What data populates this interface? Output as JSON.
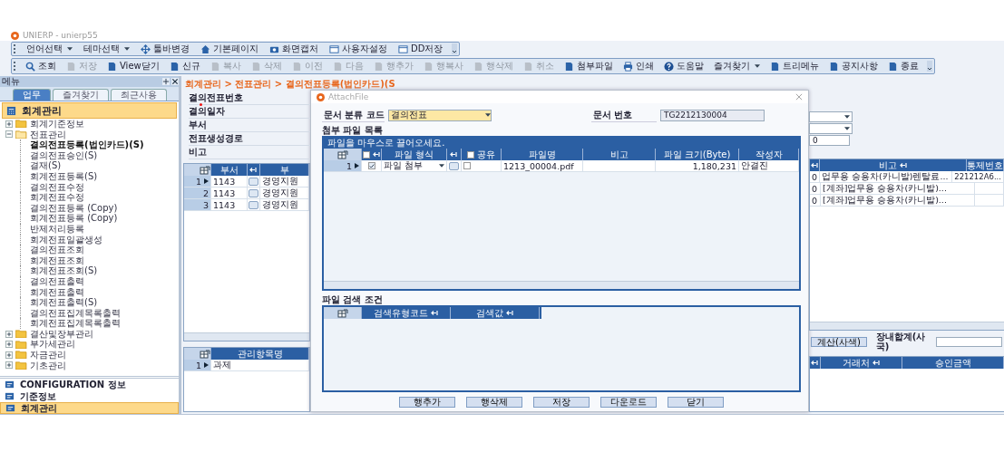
{
  "window": {
    "title": "UNIERP - unierp55"
  },
  "toolbar_top": [
    {
      "label": "언어선택",
      "dropdown": true,
      "kind": "none"
    },
    {
      "label": "테마선택",
      "dropdown": true,
      "kind": "none"
    },
    {
      "label": "툴바변경",
      "dropdown": false,
      "kind": "move"
    },
    {
      "label": "기본페이지",
      "dropdown": false,
      "kind": "home"
    },
    {
      "label": "화면캡처",
      "dropdown": false,
      "kind": "camera"
    },
    {
      "label": "사용자설정",
      "dropdown": false,
      "kind": "page"
    },
    {
      "label": "DD저장",
      "dropdown": false,
      "kind": "page"
    }
  ],
  "toolbar_main": [
    {
      "label": "조회",
      "kind": "search",
      "disabled": false,
      "dropdown": false
    },
    {
      "label": "저장",
      "kind": "page",
      "disabled": true,
      "dropdown": false
    },
    {
      "label": "View닫기",
      "kind": "page",
      "disabled": false,
      "dropdown": false
    },
    {
      "label": "신규",
      "kind": "page",
      "disabled": false,
      "dropdown": false
    },
    {
      "label": "복사",
      "kind": "page",
      "disabled": true,
      "dropdown": false
    },
    {
      "label": "삭제",
      "kind": "page",
      "disabled": true,
      "dropdown": false
    },
    {
      "label": "이전",
      "kind": "page",
      "disabled": true,
      "dropdown": false
    },
    {
      "label": "다음",
      "kind": "page",
      "disabled": true,
      "dropdown": false
    },
    {
      "label": "행추가",
      "kind": "page",
      "disabled": true,
      "dropdown": false
    },
    {
      "label": "행복사",
      "kind": "page",
      "disabled": true,
      "dropdown": false
    },
    {
      "label": "행삭제",
      "kind": "page",
      "disabled": true,
      "dropdown": false
    },
    {
      "label": "취소",
      "kind": "page",
      "disabled": true,
      "dropdown": false
    },
    {
      "label": "첨부파일",
      "kind": "page",
      "disabled": false,
      "dropdown": false
    },
    {
      "label": "인쇄",
      "kind": "print",
      "disabled": false,
      "dropdown": false
    },
    {
      "label": "도움말",
      "kind": "help",
      "disabled": false,
      "dropdown": false
    },
    {
      "label": "즐겨찾기",
      "kind": "none",
      "disabled": false,
      "dropdown": true
    },
    {
      "label": "트리메뉴",
      "kind": "page",
      "disabled": false,
      "dropdown": false
    },
    {
      "label": "공지사항",
      "kind": "page",
      "disabled": false,
      "dropdown": false
    },
    {
      "label": "종료",
      "kind": "page",
      "disabled": false,
      "dropdown": false
    }
  ],
  "sidebar": {
    "title": "메뉴",
    "tabs": [
      {
        "label": "업무",
        "selected": true
      },
      {
        "label": "즐겨찾기",
        "selected": false
      },
      {
        "label": "최근사용",
        "selected": false
      }
    ],
    "module": "회계관리",
    "tree": [
      {
        "label": "회계기준정보",
        "expanded": false
      },
      {
        "label": "전표관리",
        "expanded": true,
        "children": [
          {
            "label": "결의전표등록(법인카드)(S)",
            "selected": true
          },
          {
            "label": "결의전표승인(S)",
            "selected": false
          },
          {
            "label": "결재(S)",
            "selected": false
          },
          {
            "label": "회계전표등록(S)",
            "selected": false
          },
          {
            "label": "결의전표수정",
            "selected": false
          },
          {
            "label": "회계전표수정",
            "selected": false
          },
          {
            "label": "결의전표등록 (Copy)",
            "selected": false
          },
          {
            "label": "회계전표등록 (Copy)",
            "selected": false
          },
          {
            "label": "반제처리등록",
            "selected": false
          },
          {
            "label": "회계전표일괄생성",
            "selected": false
          },
          {
            "label": "결의전표조회",
            "selected": false
          },
          {
            "label": "회계전표조회",
            "selected": false
          },
          {
            "label": "회계전표조회(S)",
            "selected": false
          },
          {
            "label": "결의전표출력",
            "selected": false
          },
          {
            "label": "회계전표출력",
            "selected": false
          },
          {
            "label": "회계전표출력(S)",
            "selected": false
          },
          {
            "label": "결의전표집계목록출력",
            "selected": false
          },
          {
            "label": "회계전표집계목록출력",
            "selected": false
          }
        ]
      },
      {
        "label": "결산및장부관리",
        "expanded": false
      },
      {
        "label": "부가세관리",
        "expanded": false
      },
      {
        "label": "자금관리",
        "expanded": false
      },
      {
        "label": "기초관리",
        "expanded": false
      }
    ],
    "footer": [
      {
        "label": "CONFIGURATION 정보",
        "selected": false
      },
      {
        "label": "기준정보",
        "selected": false
      },
      {
        "label": "회계관리",
        "selected": true
      }
    ]
  },
  "breadcrumb": "회계관리 > 전표관리 > 결의전표등록(법인카드)(S",
  "form": [
    {
      "label": "결의전표번호",
      "required": false
    },
    {
      "label": "결의일자",
      "required": true
    },
    {
      "label": "부서",
      "required": false
    },
    {
      "label": "전표생성경로",
      "required": false
    },
    {
      "label": "비고",
      "required": false
    }
  ],
  "main_grid": {
    "columns": [
      "부서",
      "부"
    ],
    "rows": [
      {
        "num": "1",
        "current": true,
        "dept": "1143",
        "name": "경영지원"
      },
      {
        "num": "2",
        "current": false,
        "dept": "1143",
        "name": "경영지원"
      },
      {
        "num": "3",
        "current": false,
        "dept": "1143",
        "name": "경영지원"
      }
    ]
  },
  "detail_grid": {
    "columns": [
      "관리항목명"
    ],
    "rows": [
      {
        "num": "1",
        "current": true,
        "item": "과제"
      }
    ]
  },
  "right_panel": {
    "value_field": "0",
    "grid": {
      "columns": [
        "비고",
        "통제번호"
      ],
      "rows": [
        {
          "column_1": "0",
          "note": "업무용 승용차(카니발)렌탈료...",
          "control_no": "221212A6..."
        },
        {
          "column_1": "0",
          "note": "[계좌]업무용 승용차(카니발)..."
        },
        {
          "column_1": "0",
          "note": "[계좌]업무용 승용차(카니발)..."
        }
      ]
    },
    "calc_button": "계산(사색)",
    "total_label": "장내합계(사국)",
    "lower_grid": {
      "columns": [
        "거래처",
        "승인금액"
      ]
    }
  },
  "dialog": {
    "title": "AttachFile",
    "doc_class": {
      "label": "문서 분류 코드",
      "value": "결의전표"
    },
    "doc_no": {
      "label": "문서 번호",
      "value": "TG2212130004"
    },
    "list_title": "첨부 파일 목록",
    "drop_hint": "파일을 마우스로 끌어오세요.",
    "file_grid": {
      "all_checked": false,
      "all_shared": false,
      "columns": [
        "파일 형식",
        "공유",
        "파일명",
        "비고",
        "파일 크기(Byte)",
        "작성자"
      ],
      "rows": [
        {
          "num": "1",
          "current": true,
          "checked": true,
          "file_type": "파일 첨부",
          "shared": false,
          "file_name": "1213_00004.pdf",
          "size": "1,180,231",
          "author": "안결진"
        }
      ]
    },
    "search_title": "파일 검색 조건",
    "search_columns": [
      "검색유형코드",
      "검색값"
    ],
    "buttons": [
      "행추가",
      "행삭제",
      "저장",
      "다운로드",
      "닫기"
    ]
  }
}
